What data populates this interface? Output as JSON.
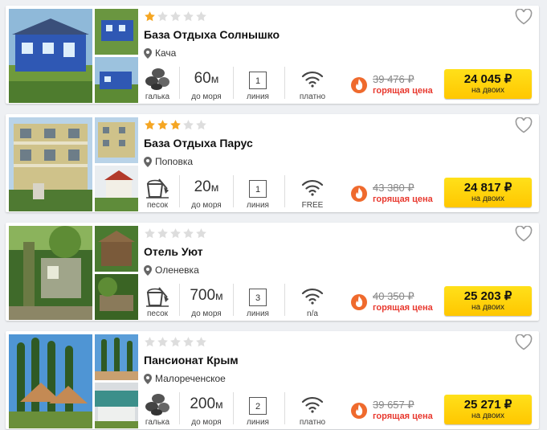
{
  "hotels": [
    {
      "name": "База Отдыха Солнышко",
      "location": "Кача",
      "stars_filled": 1,
      "beach_type": "галька",
      "distance_value": "60",
      "distance_unit": "м",
      "distance_label": "до моря",
      "line_number": "1",
      "line_label": "линия",
      "wifi_label": "платно",
      "old_price": "39 476 ₽",
      "hot_label": "горящая цена",
      "price": "24 045 ₽",
      "price_note": "на двоих"
    },
    {
      "name": "База Отдыха Парус",
      "location": "Поповка",
      "stars_filled": 3,
      "beach_type": "песок",
      "distance_value": "20",
      "distance_unit": "м",
      "distance_label": "до моря",
      "line_number": "1",
      "line_label": "линия",
      "wifi_label": "FREE",
      "old_price": "43 380 ₽",
      "hot_label": "горящая цена",
      "price": "24 817 ₽",
      "price_note": "на двоих"
    },
    {
      "name": "Отель Уют",
      "location": "Оленевка",
      "stars_filled": 0,
      "beach_type": "песок",
      "distance_value": "700",
      "distance_unit": "м",
      "distance_label": "до моря",
      "line_number": "3",
      "line_label": "линия",
      "wifi_label": "n/a",
      "old_price": "40 350 ₽",
      "hot_label": "горящая цена",
      "price": "25 203 ₽",
      "price_note": "на двоих"
    },
    {
      "name": "Пансионат Крым",
      "location": "Малореченское",
      "stars_filled": 0,
      "beach_type": "галька",
      "distance_value": "200",
      "distance_unit": "м",
      "distance_label": "до моря",
      "line_number": "2",
      "line_label": "линия",
      "wifi_label": "платно",
      "old_price": "39 657 ₽",
      "hot_label": "горящая цена",
      "price": "25 271 ₽",
      "price_note": "на двоих"
    }
  ],
  "colors": {
    "star_filled": "#f5a623",
    "star_empty": "#dddddd",
    "hot": "#e8392f",
    "button": "#ffd200"
  },
  "icons": [
    "star-icon",
    "map-pin-icon",
    "pebbles-icon",
    "sand-bucket-icon",
    "wifi-icon",
    "fire-icon",
    "heart-icon"
  ]
}
